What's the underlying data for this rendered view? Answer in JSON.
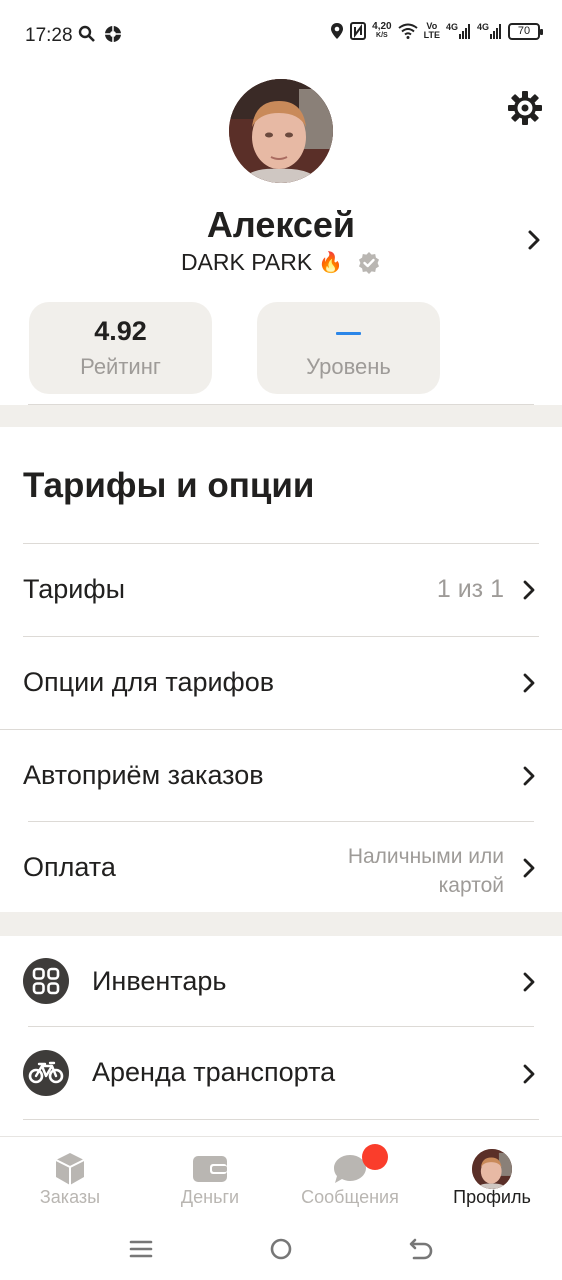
{
  "status_bar": {
    "time": "17:28",
    "speed_value": "4,20",
    "speed_unit": "K/S",
    "volte_top": "Vo",
    "volte_bottom": "LTE",
    "net1": "4G",
    "net2": "4G",
    "battery": "70"
  },
  "profile": {
    "name": "Алексей",
    "park": "DARK PARK",
    "park_emoji": "🔥"
  },
  "stats": {
    "rating_value": "4.92",
    "rating_label": "Рейтинг",
    "level_label": "Уровень"
  },
  "tariffs_section": {
    "title": "Тарифы и опции",
    "rows": [
      {
        "label": "Тарифы",
        "value": "1 из 1"
      },
      {
        "label": "Опции для тарифов",
        "value": ""
      },
      {
        "label": "Автоприём заказов",
        "value": ""
      },
      {
        "label": "Оплата",
        "value_line1": "Наличными или",
        "value_line2": "картой"
      }
    ]
  },
  "extras": {
    "rows": [
      {
        "label": "Инвентарь",
        "icon": "inventory-icon"
      },
      {
        "label": "Аренда транспорта",
        "icon": "bicycle-icon"
      }
    ]
  },
  "bottom_nav": {
    "items": [
      {
        "label": "Заказы",
        "icon": "cube-icon"
      },
      {
        "label": "Деньги",
        "icon": "wallet-icon"
      },
      {
        "label": "Сообщения",
        "icon": "chat-icon"
      },
      {
        "label": "Профиль",
        "icon": "avatar"
      }
    ],
    "active": "Профиль"
  },
  "colors": {
    "accent_blue": "#2b86e8",
    "badge_red": "#fa3d2b",
    "card_bg": "#f1efeb",
    "text_primary": "#21201f",
    "text_secondary": "#9e9b98"
  }
}
